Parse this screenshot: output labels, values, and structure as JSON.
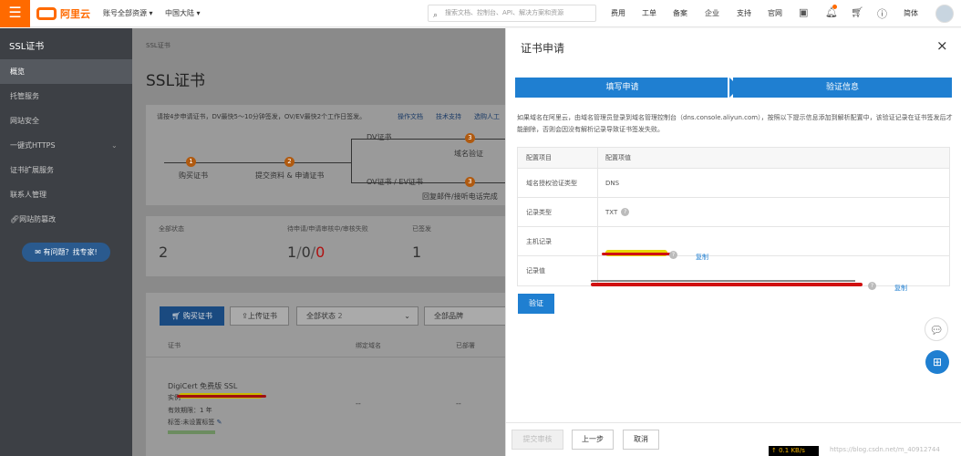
{
  "topbar": {
    "menu_icon": "☰",
    "logo": "阿里云",
    "account_scope": "账号全部资源",
    "region": "中国大陆",
    "search_placeholder": "搜索文档、控制台、API、解决方案和资源",
    "nav": [
      "费用",
      "工单",
      "备案",
      "企业",
      "支持",
      "官网"
    ],
    "lang": "简体"
  },
  "sidebar": {
    "title": "SSL证书",
    "items": [
      "概览",
      "托管服务",
      "网站安全",
      "一键式HTTPS",
      "证书扩展服务",
      "联系人管理",
      "网站防篡改"
    ],
    "help": "有问题？找专家!"
  },
  "main": {
    "breadcrumb": "SSL证书",
    "title": "SSL证书",
    "notice": "请按4步申请证书，DV最快5～10分钟签发，OV/EV最快2个工作日签发。",
    "notice_links": [
      "操作文档",
      "技术支持",
      "选购人工"
    ],
    "flow": {
      "s1": "购买证书",
      "s2": "提交资料 & 申请证书",
      "dv": "DV证书",
      "ov": "OV证书 / EV证书",
      "s3a": "域名验证",
      "s3b": "回复邮件/接听电话完成",
      "n1": "1",
      "n2": "2",
      "n3": "3"
    },
    "stats": [
      {
        "label": "全部状态",
        "value": "2"
      },
      {
        "label": "待申请/申请审核中/审核失败",
        "v1": "1",
        "sep1": "/",
        "v2": "0",
        "sep2": "/",
        "v3": "0"
      },
      {
        "label": "已签发",
        "value": "1"
      }
    ],
    "buttons": {
      "buy": "购买证书",
      "upload": "上传证书",
      "filter1": "全部状态",
      "filter1_count": "2",
      "filter2": "全部品牌"
    },
    "columns": [
      "证书",
      "绑定域名",
      "已部署"
    ],
    "row": {
      "name": "DigiCert 免费版 SSL",
      "prefix": "实例",
      "validity": "有效期限：1 年",
      "tag": "标签:未设置标签",
      "dash1": "--",
      "dash2": "--"
    }
  },
  "drawer": {
    "title": "证书申请",
    "close_icon": "×",
    "steps": [
      "填写申请",
      "验证信息"
    ],
    "intro": "如果域名在阿里云，由域名管理员登录到域名管理控制台（dns.console.aliyun.com），按照以下提示信息添加到解析配置中，该验证记录在证书签发后才能删除，否则会因没有解析记录导致证书签发失败。",
    "table": {
      "header": [
        "配置项目",
        "配置项值"
      ],
      "rows": [
        {
          "label": "域名授权验证类型",
          "value": "DNS"
        },
        {
          "label": "记录类型",
          "value": "TXT"
        },
        {
          "label": "主机记录",
          "value": "",
          "copy": "复制"
        },
        {
          "label": "记录值",
          "value": "",
          "copy": "复制"
        }
      ]
    },
    "verify": "验证",
    "footer": {
      "submit": "提交审核",
      "prev": "上一步",
      "cancel": "取消"
    }
  },
  "status": {
    "speed": "↑ 0.1 KB/s",
    "watermark": "https://blog.csdn.net/m_40912744"
  }
}
